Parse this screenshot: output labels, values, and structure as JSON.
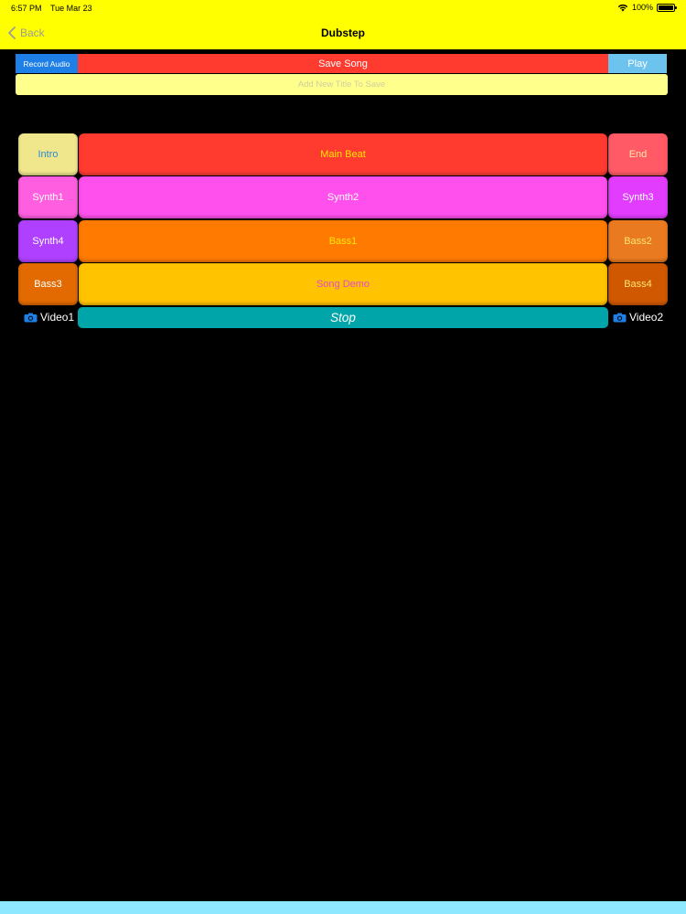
{
  "status_bar": {
    "time": "6:57 PM",
    "date": "Tue Mar 23",
    "battery": "100%"
  },
  "nav": {
    "back_label": "Back",
    "title": "Dubstep"
  },
  "toolbar": {
    "record_audio": "Record Audio",
    "save_song": "Save Song",
    "play": "Play"
  },
  "title_input": {
    "placeholder": "Add New Title To Save",
    "value": ""
  },
  "pads": [
    {
      "label": "Intro",
      "color": "#f0e68c",
      "text_color": "#2a8bd6"
    },
    {
      "label": "Main Beat",
      "color": "#ff3b30",
      "text_color": "#ffe600"
    },
    {
      "label": "End",
      "color": "#ff5a66",
      "text_color": "#ffe9a8"
    },
    {
      "label": "Synth1",
      "color": "#ff5ee0",
      "text_color": "#ffffff"
    },
    {
      "label": "Synth2",
      "color": "#ff50ee",
      "text_color": "#ffffff"
    },
    {
      "label": "Synth3",
      "color": "#e23cff",
      "text_color": "#ffffff"
    },
    {
      "label": "Synth4",
      "color": "#b040ff",
      "text_color": "#ffffff"
    },
    {
      "label": "Bass1",
      "color": "#ff7a00",
      "text_color": "#ffe600"
    },
    {
      "label": "Bass2",
      "color": "#ea7a20",
      "text_color": "#ffe66e"
    },
    {
      "label": "Bass3",
      "color": "#e26a00",
      "text_color": "#ffffff"
    },
    {
      "label": "Song Demo",
      "color": "#ffc300",
      "text_color": "#e34ad3"
    },
    {
      "label": "Bass4",
      "color": "#d05800",
      "text_color": "#ffe66e"
    }
  ],
  "video_buttons": {
    "left": "Video1",
    "right": "Video2"
  },
  "stop_label": "Stop",
  "colors": {
    "top_bar": "#ffff00",
    "background": "#000000",
    "accent_blue": "#1e7fe6",
    "stop": "#00a5aa",
    "bottom_strip": "#8ee8ff"
  }
}
